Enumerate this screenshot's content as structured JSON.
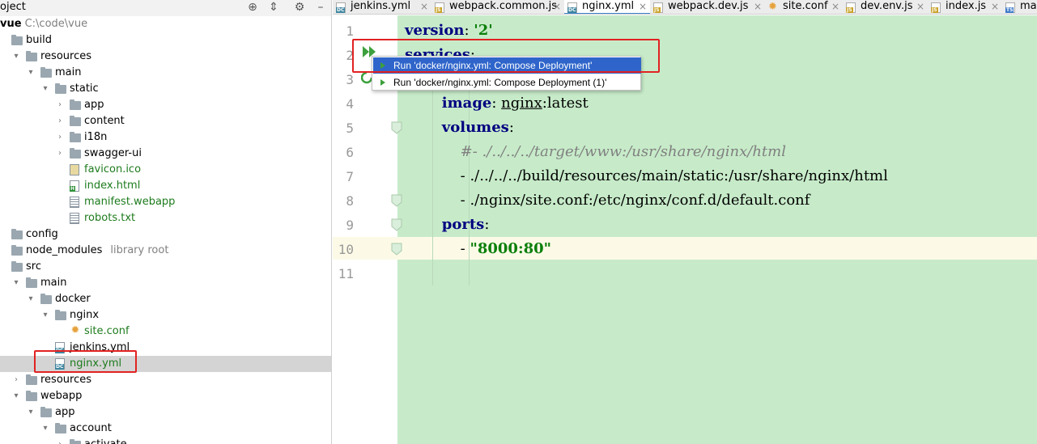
{
  "project_panel": {
    "title": "oject",
    "tree": [
      {
        "label": "vue",
        "hint": "C:\\code\\vue",
        "type": "root",
        "arrow": "",
        "depth": 0
      },
      {
        "label": "build",
        "type": "folder",
        "arrow": "",
        "depth": 0
      },
      {
        "label": "resources",
        "type": "folder",
        "arrow": "▾",
        "depth": 1
      },
      {
        "label": "main",
        "type": "folder",
        "arrow": "▾",
        "depth": 2
      },
      {
        "label": "static",
        "type": "folder",
        "arrow": "▾",
        "depth": 3
      },
      {
        "label": "app",
        "type": "folder",
        "arrow": "›",
        "depth": 4
      },
      {
        "label": "content",
        "type": "folder",
        "arrow": "›",
        "depth": 4
      },
      {
        "label": "i18n",
        "type": "folder",
        "arrow": "›",
        "depth": 4
      },
      {
        "label": "swagger-ui",
        "type": "folder",
        "arrow": "›",
        "depth": 4
      },
      {
        "label": "favicon.ico",
        "type": "file-ico",
        "depth": 4,
        "color": "green"
      },
      {
        "label": "index.html",
        "type": "file-html",
        "depth": 4,
        "color": "green"
      },
      {
        "label": "manifest.webapp",
        "type": "file-txt",
        "depth": 4,
        "color": "green"
      },
      {
        "label": "robots.txt",
        "type": "file-txt",
        "depth": 4,
        "color": "green"
      },
      {
        "label": "config",
        "type": "folder",
        "arrow": "",
        "depth": 0
      },
      {
        "label": "node_modules",
        "hint": "library root",
        "type": "folder",
        "arrow": "",
        "depth": 0
      },
      {
        "label": "src",
        "type": "folder",
        "arrow": "",
        "depth": 0
      },
      {
        "label": "main",
        "type": "folder",
        "arrow": "▾",
        "depth": 1
      },
      {
        "label": "docker",
        "type": "folder",
        "arrow": "▾",
        "depth": 2
      },
      {
        "label": "nginx",
        "type": "folder",
        "arrow": "▾",
        "depth": 3
      },
      {
        "label": "site.conf",
        "type": "file-conf",
        "depth": 4,
        "color": "green"
      },
      {
        "label": "jenkins.yml",
        "type": "file-dc",
        "depth": 3
      },
      {
        "label": "nginx.yml",
        "type": "file-dc",
        "depth": 3,
        "color": "green",
        "selected": true
      },
      {
        "label": "resources",
        "type": "folder",
        "arrow": "›",
        "depth": 1
      },
      {
        "label": "webapp",
        "type": "folder",
        "arrow": "▾",
        "depth": 1
      },
      {
        "label": "app",
        "type": "folder",
        "arrow": "▾",
        "depth": 2
      },
      {
        "label": "account",
        "type": "folder",
        "arrow": "▾",
        "depth": 3
      },
      {
        "label": "activate",
        "type": "folder",
        "arrow": "›",
        "depth": 4
      }
    ],
    "header_icons": [
      "target-icon",
      "collapse-icon",
      "settings-gear-icon",
      "hide-icon"
    ]
  },
  "tabs": [
    {
      "label": "jenkins.yml",
      "icon": "dc"
    },
    {
      "label": "webpack.common.js",
      "icon": "js"
    },
    {
      "label": "nginx.yml",
      "icon": "dc",
      "active": true
    },
    {
      "label": "webpack.dev.js",
      "icon": "js"
    },
    {
      "label": "site.conf",
      "icon": "gear"
    },
    {
      "label": "dev.env.js",
      "icon": "js"
    },
    {
      "label": "index.js",
      "icon": "js"
    },
    {
      "label": "mai",
      "icon": "ts"
    }
  ],
  "editor": {
    "file": "nginx.yml",
    "line_numbers": [
      "1",
      "2",
      "3",
      "4",
      "5",
      "6",
      "7",
      "8",
      "9",
      "10",
      "11"
    ],
    "current_line": 10,
    "lines": [
      [
        {
          "t": "version",
          "c": "kw"
        },
        {
          "t": ": "
        },
        {
          "t": "'2'",
          "c": "str"
        }
      ],
      [
        {
          "t": "services",
          "c": "kw"
        },
        {
          "t": ":"
        }
      ],
      [],
      [
        {
          "t": "        "
        },
        {
          "t": "image",
          "c": "kw"
        },
        {
          "t": ": "
        },
        {
          "t": "nginx",
          "c": "ul"
        },
        {
          "t": ":latest"
        }
      ],
      [
        {
          "t": "        "
        },
        {
          "t": "volumes",
          "c": "kw"
        },
        {
          "t": ":"
        }
      ],
      [
        {
          "t": "            "
        },
        {
          "t": "#- ./../../../target/www:/usr/share/nginx/html",
          "c": "cmt"
        }
      ],
      [
        {
          "t": "            - ./../../../build/resources/main/static:/usr/share/nginx/html"
        }
      ],
      [
        {
          "t": "            - ./nginx/site.conf:/etc/nginx/conf.d/default.conf"
        }
      ],
      [
        {
          "t": "        "
        },
        {
          "t": "ports",
          "c": "kw"
        },
        {
          "t": ":"
        }
      ],
      [
        {
          "t": "            - "
        },
        {
          "t": "\"8000:80\"",
          "c": "str"
        }
      ],
      []
    ]
  },
  "run_popup": {
    "items": [
      {
        "label": "Run 'docker/nginx.yml: Compose Deployment'",
        "selected": true
      },
      {
        "label": "Run 'docker/nginx.yml: Compose Deployment (1)'",
        "selected": false
      }
    ]
  },
  "colors": {
    "editor_bg": "#c7ebc9",
    "selection_bg": "#2f65ca",
    "annotation": "#e22222",
    "keyword": "#000080",
    "string": "#0b7f0b"
  }
}
